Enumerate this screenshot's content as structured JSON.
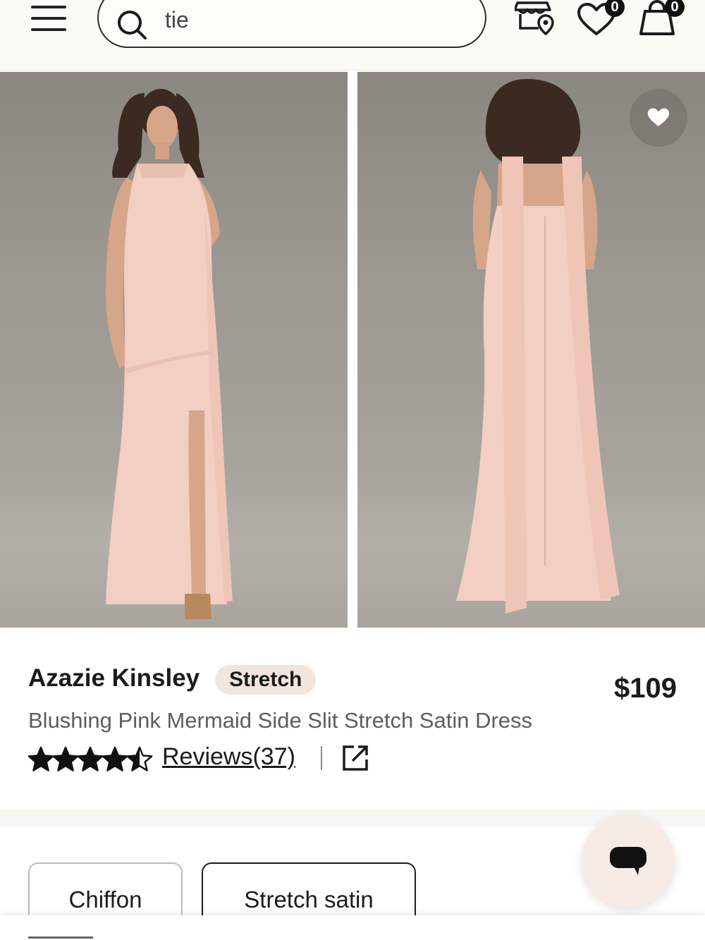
{
  "header": {
    "search_value": "tie",
    "wishlist_count": "0",
    "cart_count": "0"
  },
  "product": {
    "brand": "Azazie Kinsley",
    "tag": "Stretch",
    "price": "$109",
    "title": "Blushing Pink Mermaid Side Slit Stretch Satin Dress",
    "rating": 4.5,
    "rating_max": 5,
    "reviews_label": "Reviews(37)"
  },
  "fabrics": [
    {
      "label": "Chiffon",
      "selected": false
    },
    {
      "label": "Stretch satin",
      "selected": true
    }
  ],
  "icons": {
    "menu": "hamburger-icon",
    "search": "search-icon",
    "store": "store-locator-icon",
    "wishlist": "heart-icon",
    "cart": "shopping-bag-icon",
    "favorite": "heart-icon",
    "share": "external-link-icon",
    "chat": "chat-bubble-icon"
  },
  "colors": {
    "dress": "#f2cfc2",
    "tag_bg": "#f1e5dd",
    "chat_bg": "#f6ebe5"
  }
}
